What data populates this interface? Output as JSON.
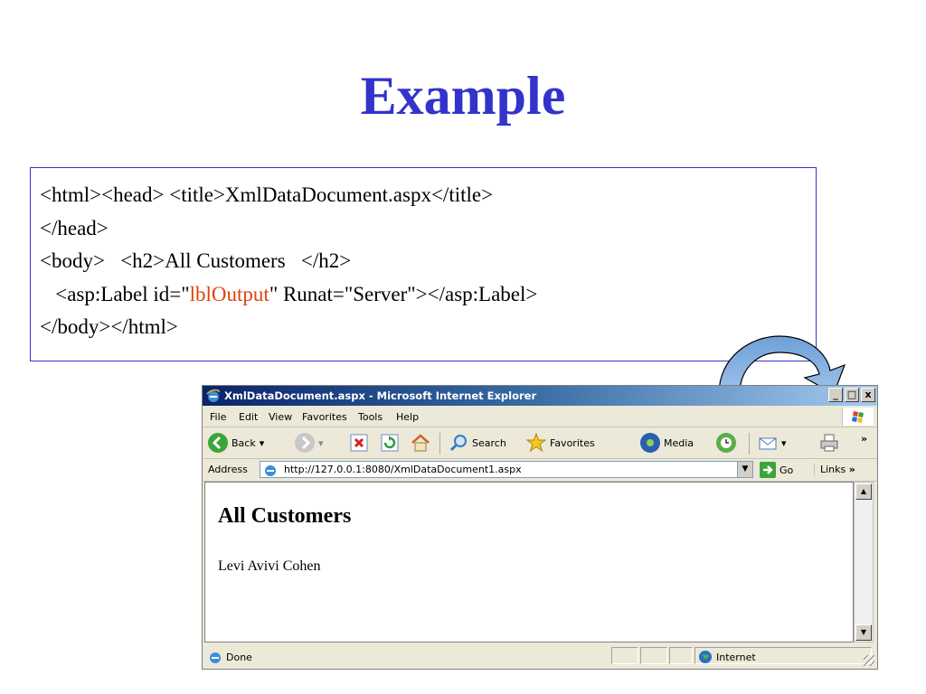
{
  "slide": {
    "title": "Example",
    "code_lines": [
      "<html><head> <title>XmlDataDocument.aspx</title>",
      "</head>",
      "<body>   <h2>All Customers   </h2>"
    ],
    "code_line4": {
      "prefix": "   <asp:Label id=\"",
      "highlight": "lblOutput",
      "suffix": "\" Runat=\"Server\"></asp:Label>"
    },
    "code_line5": "</body></html>",
    "highlight_color": "#e0440e",
    "title_color": "#3333cc"
  },
  "browser": {
    "window_title": "XmlDataDocument.aspx - Microsoft Internet Explorer",
    "window_buttons": [
      "_",
      "□",
      "x"
    ],
    "menu": [
      "File",
      "Edit",
      "View",
      "Favorites",
      "Tools",
      "Help"
    ],
    "toolbar": {
      "back": "Back",
      "search": "Search",
      "favorites": "Favorites",
      "media": "Media"
    },
    "address": {
      "label": "Address",
      "url": "http://127.0.0.1:8080/XmlDataDocument1.aspx",
      "go": "Go",
      "links": "Links"
    },
    "page": {
      "heading": "All Customers",
      "output": "Levi Avivi Cohen"
    },
    "status": {
      "text": "Done",
      "zone": "Internet"
    },
    "icons": [
      "ie-icon",
      "windows-flag-icon",
      "back-arrow-icon",
      "forward-arrow-icon",
      "stop-icon",
      "refresh-icon",
      "home-icon",
      "search-icon",
      "favorites-star-icon",
      "media-icon",
      "history-icon",
      "mail-icon",
      "print-icon",
      "go-arrow-icon",
      "globe-icon"
    ]
  }
}
